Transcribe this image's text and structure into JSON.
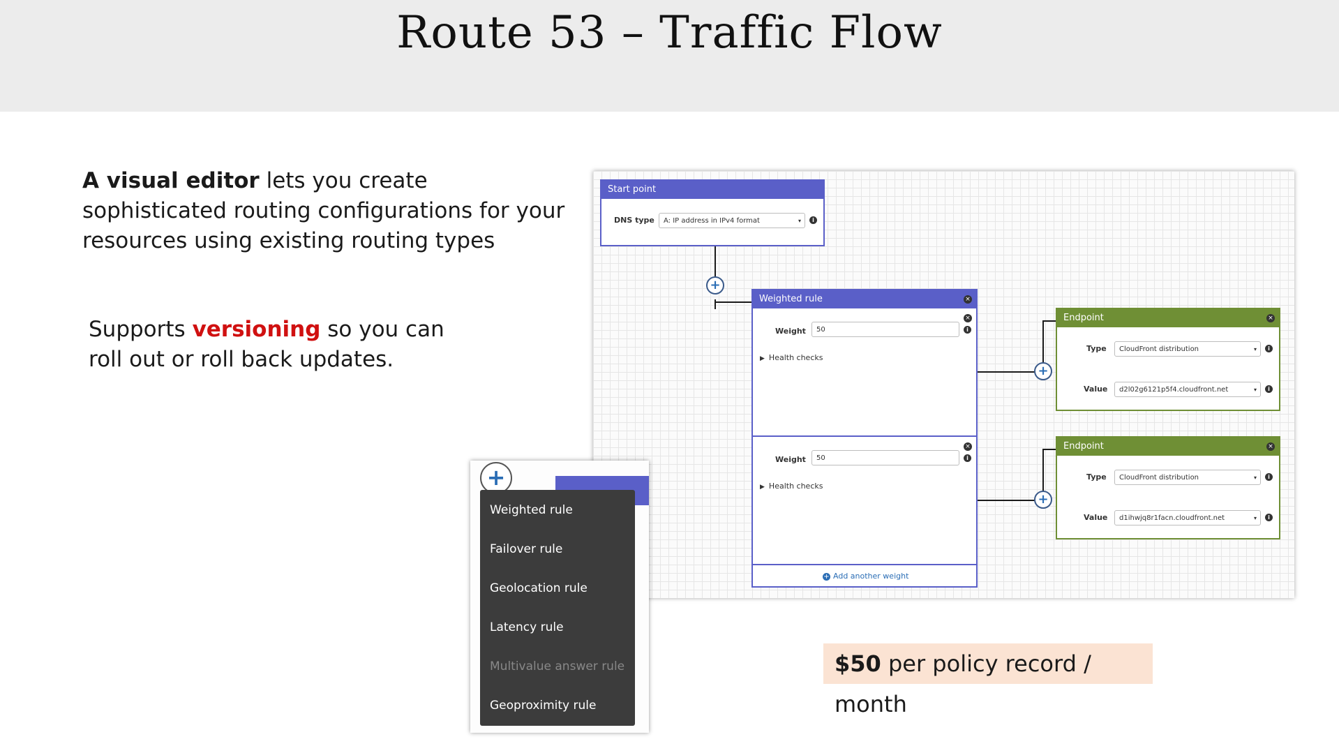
{
  "title": "Route 53 – Traffic Flow",
  "intro": {
    "bold": "A visual editor",
    "rest": " lets you create sophisticated routing configurations for your resources using existing routing types"
  },
  "supports": {
    "pre": "Supports ",
    "highlight": "versioning",
    "post": " so you can roll out or roll back updates."
  },
  "price": {
    "amount": "$50",
    "text": " per policy record / month"
  },
  "editor": {
    "start_point": {
      "header": "Start point",
      "dns_type_label": "DNS type",
      "dns_type_value": "A: IP address in IPv4 format"
    },
    "weighted_rule": {
      "header": "Weighted rule",
      "weights": [
        {
          "label": "Weight",
          "value": "50",
          "health": "Health checks"
        },
        {
          "label": "Weight",
          "value": "50",
          "health": "Health checks"
        }
      ],
      "add_weight": "Add another weight"
    },
    "endpoints": [
      {
        "header": "Endpoint",
        "type_label": "Type",
        "type_value": "CloudFront distribution",
        "value_label": "Value",
        "value_value": "d2l02g6121p5f4.cloudfront.net"
      },
      {
        "header": "Endpoint",
        "type_label": "Type",
        "type_value": "CloudFront distribution",
        "value_label": "Value",
        "value_value": "d1ihwjq8r1facn.cloudfront.net"
      }
    ]
  },
  "rule_menu": {
    "items": [
      {
        "label": "Weighted rule",
        "enabled": true
      },
      {
        "label": "Failover rule",
        "enabled": true
      },
      {
        "label": "Geolocation rule",
        "enabled": true
      },
      {
        "label": "Latency rule",
        "enabled": true
      },
      {
        "label": "Multivalue answer rule",
        "enabled": false
      },
      {
        "label": "Geoproximity rule",
        "enabled": true
      }
    ]
  },
  "colors": {
    "rule_header": "#5a5fc8",
    "endpoint_header": "#6f8f35",
    "highlight": "#d01010",
    "price_bg": "#fbe3d3"
  }
}
